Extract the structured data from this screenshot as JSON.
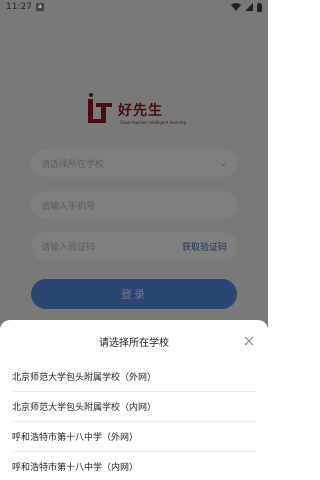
{
  "status_bar": {
    "time": "11:27",
    "notification_icon": "a"
  },
  "logo": {
    "name": "好先生",
    "tagline": "Good teacher intelligent learning"
  },
  "form": {
    "school_placeholder": "请选择所在学校",
    "phone_placeholder": "请输入手机号",
    "code_placeholder": "请输入验证码",
    "get_code_label": "获取验证码",
    "login_label": "登录"
  },
  "sheet": {
    "title": "请选择所在学校",
    "schools": [
      {
        "label": "北京师范大学包头附属学校（外网）"
      },
      {
        "label": "北京师范大学包头附属学校（内网）"
      },
      {
        "label": "呼和浩特市第十八中学（外网）"
      },
      {
        "label": "呼和浩特市第十八中学（内网）"
      }
    ]
  },
  "colors": {
    "accent": "#5b8de8",
    "link": "#3d6fb4",
    "brand": "#8d1a1f"
  }
}
